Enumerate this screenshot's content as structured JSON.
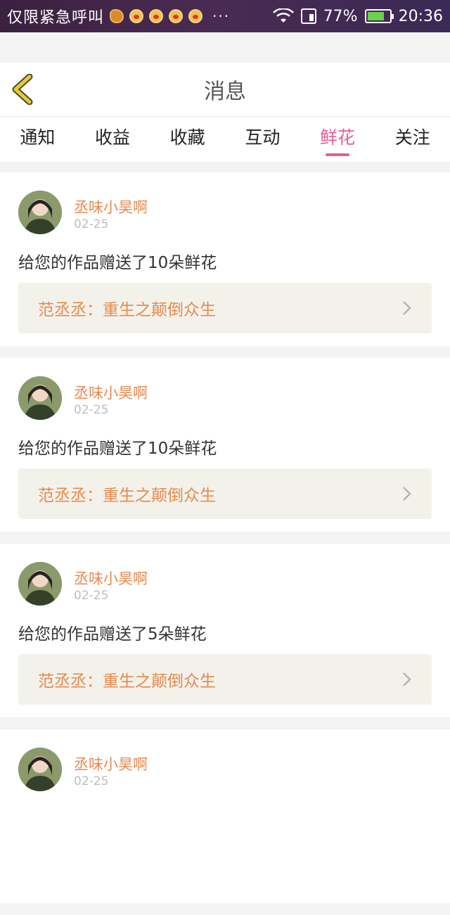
{
  "status_bar": {
    "carrier": "仅限紧急呼叫",
    "more": "···",
    "battery": "77%",
    "battery_level": 0.77,
    "time": "20:36",
    "icons": [
      "squirrel-icon",
      "weibo-icon",
      "weibo-icon",
      "weibo-icon",
      "weibo-icon"
    ]
  },
  "header": {
    "title": "消息"
  },
  "tabs": [
    {
      "label": "通知",
      "active": false
    },
    {
      "label": "收益",
      "active": false
    },
    {
      "label": "收藏",
      "active": false
    },
    {
      "label": "互动",
      "active": false
    },
    {
      "label": "鲜花",
      "active": true
    },
    {
      "label": "关注",
      "active": false
    }
  ],
  "colors": {
    "accent": "#e45f95",
    "username": "#e6894f",
    "back_arrow": "#e8c93a"
  },
  "messages": [
    {
      "user": "丞味小昊啊",
      "date": "02-25",
      "text": "给您的作品赠送了10朵鲜花",
      "work": "范丞丞：重生之颠倒众生"
    },
    {
      "user": "丞味小昊啊",
      "date": "02-25",
      "text": "给您的作品赠送了10朵鲜花",
      "work": "范丞丞：重生之颠倒众生"
    },
    {
      "user": "丞味小昊啊",
      "date": "02-25",
      "text": "给您的作品赠送了5朵鲜花",
      "work": "范丞丞：重生之颠倒众生"
    },
    {
      "user": "丞味小昊啊",
      "date": "02-25",
      "text": "",
      "work": ""
    }
  ]
}
